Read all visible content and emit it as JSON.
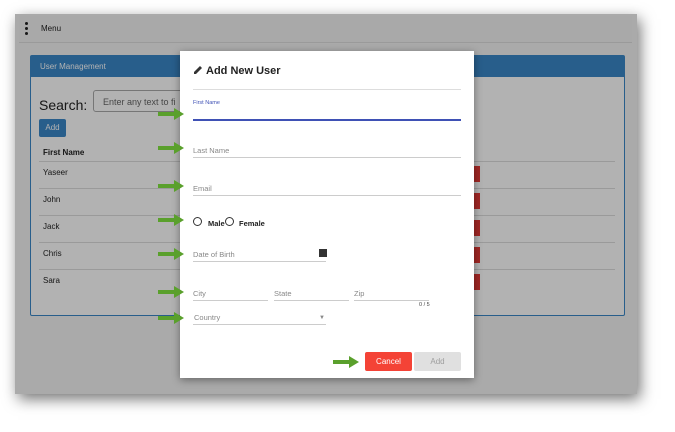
{
  "menubar": {
    "label": "Menu",
    "icon": "kebab-menu-icon"
  },
  "card": {
    "title": "User Management"
  },
  "search": {
    "label": "Search:",
    "placeholder": "Enter any text to fi"
  },
  "table": {
    "add_label": "Add",
    "column_header": "First Name",
    "rows": [
      "Yaseer",
      "John",
      "Jack",
      "Chris",
      "Sara"
    ]
  },
  "modal": {
    "title": "Add New User",
    "title_icon": "pencil-icon",
    "fields": {
      "first_name": "First Name",
      "last_name": "Last Name",
      "email": "Email",
      "date_of_birth": "Date of Birth",
      "city": "City",
      "state": "State",
      "zip": "Zip",
      "zip_counter": "0 / 5",
      "country": "Country"
    },
    "gender": {
      "male": "Male",
      "female": "Female"
    },
    "buttons": {
      "cancel": "Cancel",
      "add": "Add"
    }
  },
  "colors": {
    "primary": "#3a87c8",
    "accent": "#3f51b5",
    "danger": "#f44336",
    "annotation_arrow": "#5aa02c"
  }
}
